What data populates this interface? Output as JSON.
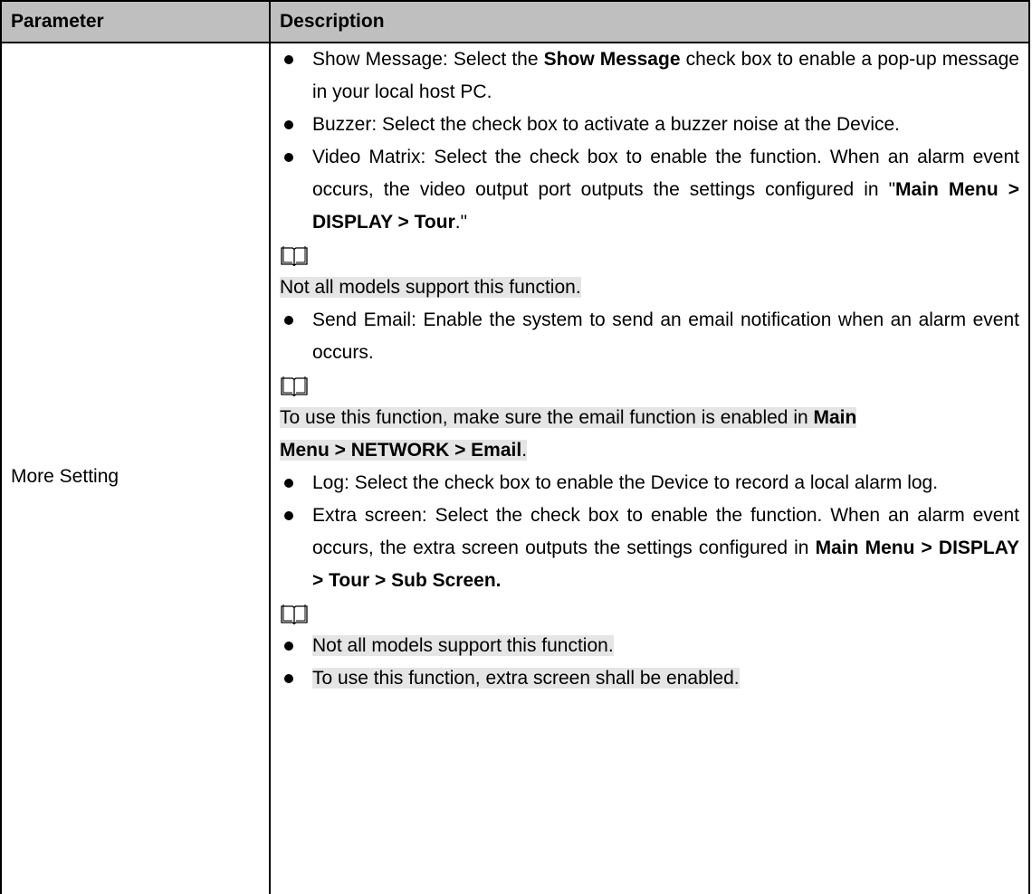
{
  "table": {
    "header": {
      "parameter": "Parameter",
      "description": "Description"
    },
    "row": {
      "parameter": "More Setting"
    }
  },
  "items": {
    "show_message": {
      "pre": "Show Message: Select the ",
      "bold": "Show Message",
      "post": " check box to enable a pop-up message in your local host PC."
    },
    "buzzer": {
      "text": "Buzzer: Select the check box to activate a buzzer noise at the Device."
    },
    "video_matrix": {
      "pre": "Video Matrix: Select the check box to enable the function. When an alarm event occurs, the video output port outputs the settings configured in \"",
      "bold": "Main Menu > DISPLAY > Tour",
      "post": ".\""
    },
    "note1": {
      "text": "Not all models support this function."
    },
    "send_email": {
      "text": "Send Email: Enable the system to send an email notification when an alarm event occurs."
    },
    "note2": {
      "pre": "To use this function, make sure the email function is enabled in ",
      "bold1": "Main",
      "bold2": "Menu > NETWORK > Email",
      "post": "."
    },
    "log": {
      "text": "Log: Select the check box to enable the Device to record a local alarm log."
    },
    "extra_screen": {
      "pre": "Extra screen: Select the check box to enable the function. When an alarm event occurs, the extra screen outputs the settings configured in ",
      "bold": "Main Menu > DISPLAY > Tour > Sub Screen."
    },
    "note3": {
      "bullet1": "Not all models support this function.",
      "bullet2": "To use this function, extra screen shall be enabled."
    }
  },
  "icons": {
    "note": "note-book-icon"
  },
  "colors": {
    "header_bg": "#bfbfbf",
    "note_highlight": "#e5e5e5",
    "border": "#000000"
  }
}
